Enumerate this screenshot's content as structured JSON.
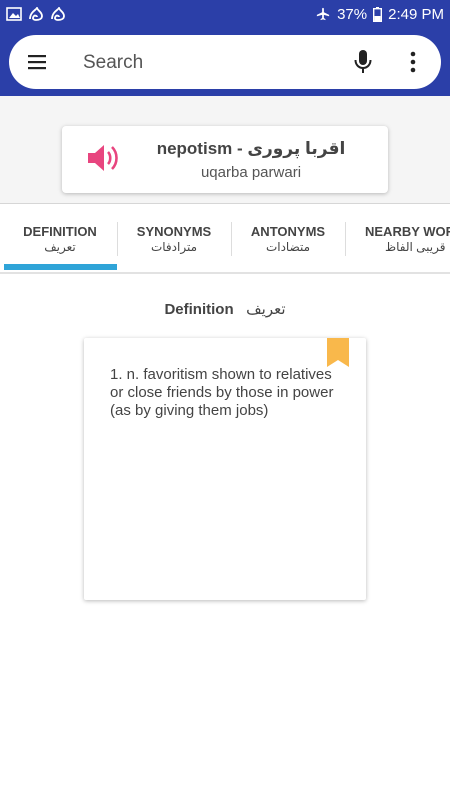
{
  "statusbar": {
    "battery": "37%",
    "time": "2:49 PM",
    "icons": [
      "image-icon",
      "app-icon",
      "app-icon",
      "airplane-icon",
      "battery-icon"
    ]
  },
  "search": {
    "placeholder": "Search"
  },
  "word": {
    "title": "nepotism - اقربا پروری",
    "romanization": "uqarba parwari"
  },
  "tabs": [
    {
      "en": "DEFINITION",
      "ur": "تعریف"
    },
    {
      "en": "SYNONYMS",
      "ur": "مترادفات"
    },
    {
      "en": "ANTONYMS",
      "ur": "متضادات"
    },
    {
      "en": "NEARBY WORDS",
      "ur": "قریبی الفاظ"
    }
  ],
  "definition": {
    "heading_en": "Definition",
    "heading_ur": "تعریف",
    "text": "1. n. favoritism shown to relatives or close friends by those in power (as by giving them jobs)"
  },
  "colors": {
    "primary": "#2b3fa8",
    "accent_tab": "#2fa4d8",
    "speaker": "#e8457f",
    "bookmark": "#f9b84b"
  }
}
